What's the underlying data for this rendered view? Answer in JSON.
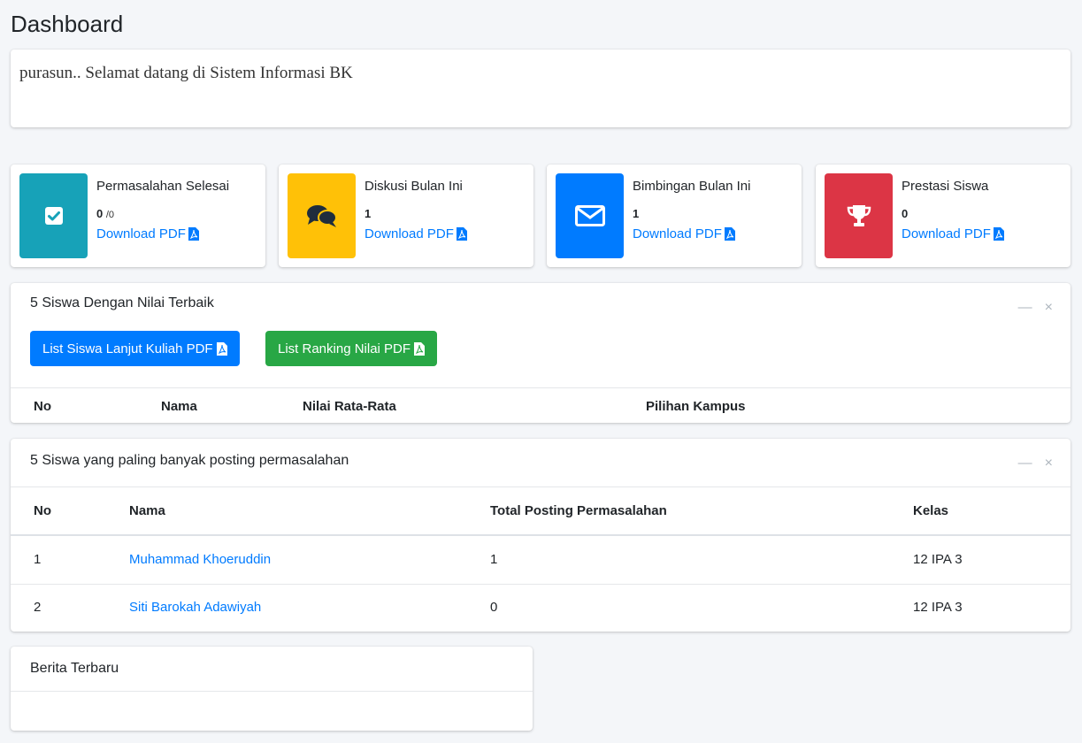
{
  "page": {
    "title": "Dashboard"
  },
  "welcome": {
    "text": "purasun.. Selamat datang di Sistem Informasi BK"
  },
  "info_boxes": [
    {
      "label": "Permasalahan Selesai",
      "number": "0",
      "sub": "/0",
      "link": "Download PDF",
      "color": "#17a2b8",
      "icon": "check-square-icon"
    },
    {
      "label": "Diskusi Bulan Ini",
      "number": "1",
      "link": "Download PDF",
      "color": "#ffc107",
      "icon": "comments-icon"
    },
    {
      "label": "Bimbingan Bulan Ini",
      "number": "1",
      "link": "Download PDF",
      "color": "#007bff",
      "icon": "envelope-icon"
    },
    {
      "label": "Prestasi Siswa",
      "number": "0",
      "link": "Download PDF",
      "color": "#dc3545",
      "icon": "trophy-icon"
    }
  ],
  "top_students": {
    "title": "5 Siswa Dengan Nilai Terbaik",
    "buttons": [
      {
        "label": "List Siswa Lanjut Kuliah PDF",
        "color": "#007bff"
      },
      {
        "label": "List Ranking Nilai PDF",
        "color": "#28a745"
      }
    ],
    "columns": [
      "No",
      "Nama",
      "Nilai Rata-Rata",
      "Pilihan Kampus"
    ],
    "rows": []
  },
  "most_posts": {
    "title": "5 Siswa yang paling banyak posting permasalahan",
    "columns": [
      "No",
      "Nama",
      "Total Posting Permasalahan",
      "Kelas"
    ],
    "rows": [
      {
        "no": "1",
        "nama": "Muhammad Khoeruddin",
        "total": "1",
        "kelas": "12 IPA 3"
      },
      {
        "no": "2",
        "nama": "Siti Barokah Adawiyah",
        "total": "0",
        "kelas": "12 IPA 3"
      }
    ]
  },
  "news": {
    "title": "Berita Terbaru"
  },
  "tools": {
    "collapse": "—",
    "remove": "×"
  }
}
